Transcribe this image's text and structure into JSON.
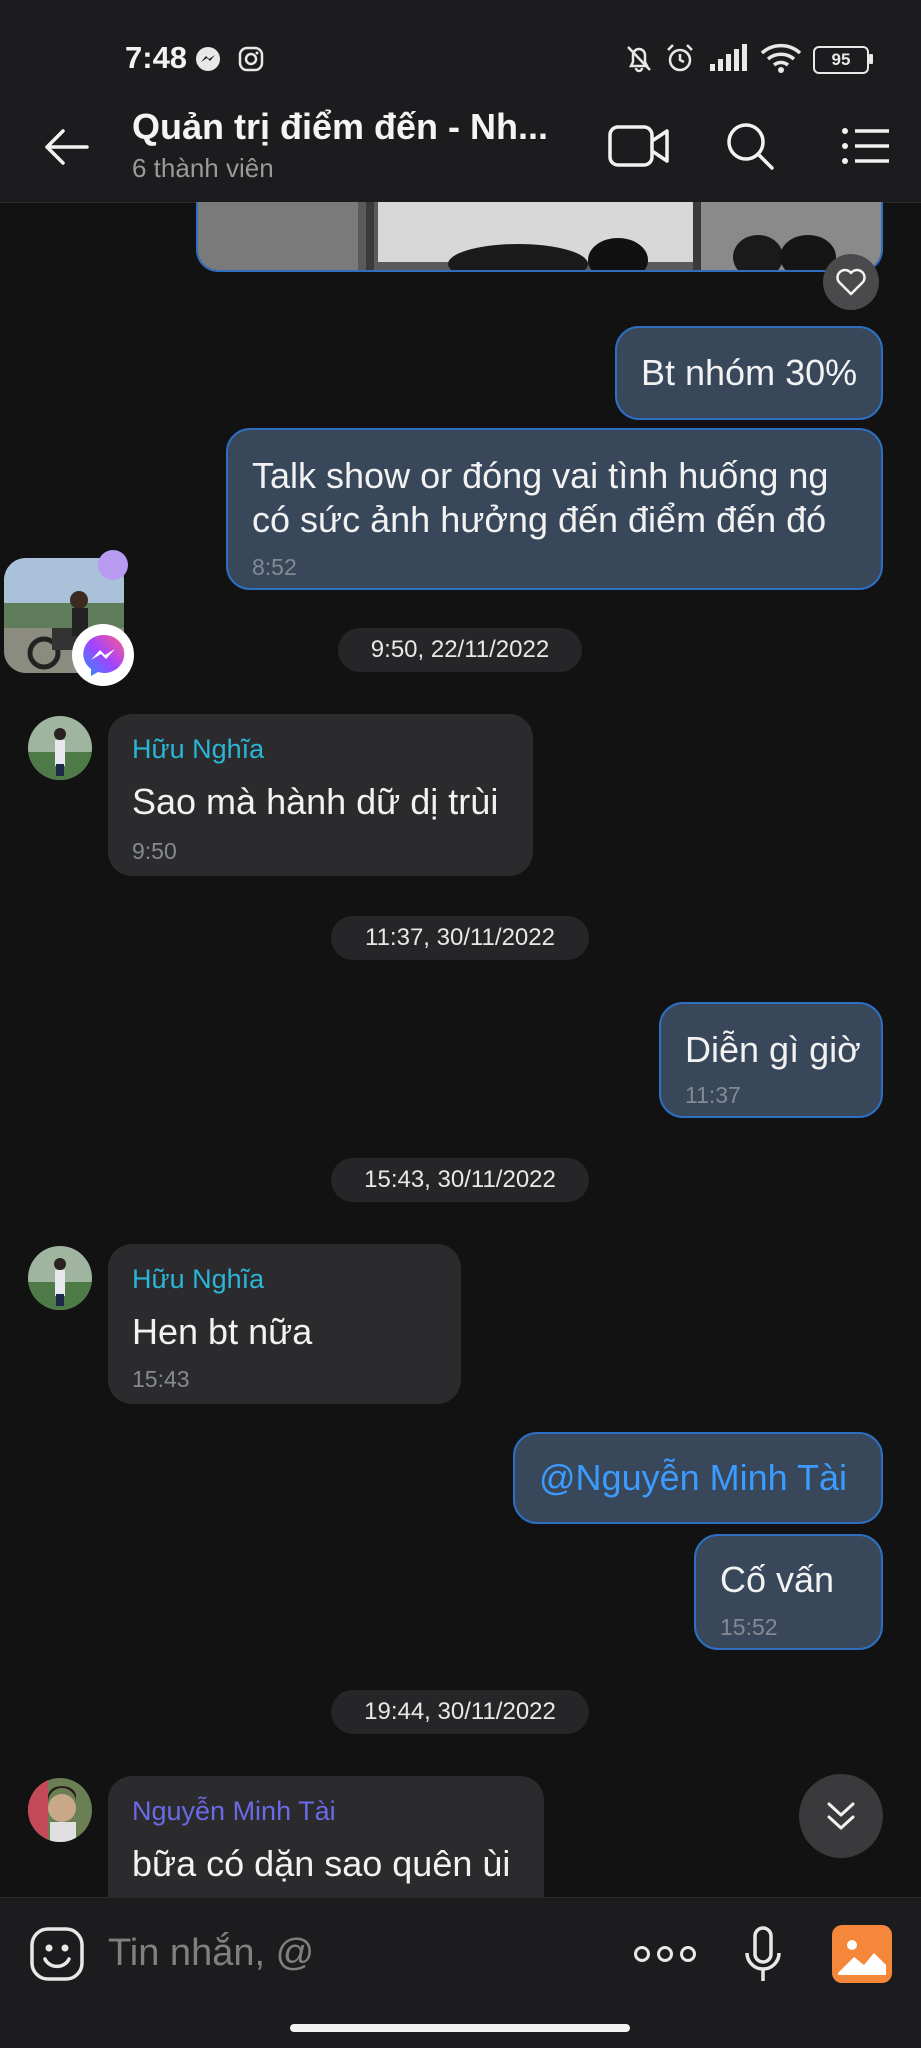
{
  "status": {
    "time": "7:48",
    "battery": "95"
  },
  "header": {
    "title": "Quản trị điểm đến - Nh...",
    "subtitle": "6 thành viên"
  },
  "messages": [
    {
      "text": "Bt nhóm 30%"
    },
    {
      "text_line1": "Talk show or đóng vai tình huống ng",
      "text_line2": "có sức ảnh hưởng đến điểm đến đó",
      "time": "8:52"
    },
    {
      "date": "9:50, 22/11/2022"
    },
    {
      "sender": "Hữu Nghĩa",
      "text": "Sao mà hành dữ dị trùi",
      "time": "9:50"
    },
    {
      "date": "11:37, 30/11/2022"
    },
    {
      "text": "Diễn gì giờ",
      "time": "11:37"
    },
    {
      "date": "15:43, 30/11/2022"
    },
    {
      "sender": "Hữu Nghĩa",
      "text": "Hen bt nữa",
      "time": "15:43"
    },
    {
      "mention": "@Nguyễn Minh Tài"
    },
    {
      "text": "Cố vấn",
      "time": "15:52"
    },
    {
      "date": "19:44, 30/11/2022"
    },
    {
      "sender": "Nguyễn Minh Tài",
      "text": "bữa có dặn sao quên ùi"
    }
  ],
  "input": {
    "placeholder": "Tin nhắn, @"
  },
  "colors": {
    "background": "#121212",
    "outgoing_bubble": "#38475a",
    "outgoing_border": "#2e6fc4",
    "incoming_bubble": "#2b2b2d",
    "sender_huu_nghia": "#2bb5d6",
    "sender_minh_tai": "#6a6ae6",
    "mention": "#3b9bff",
    "photo_button": "#f5873b"
  }
}
